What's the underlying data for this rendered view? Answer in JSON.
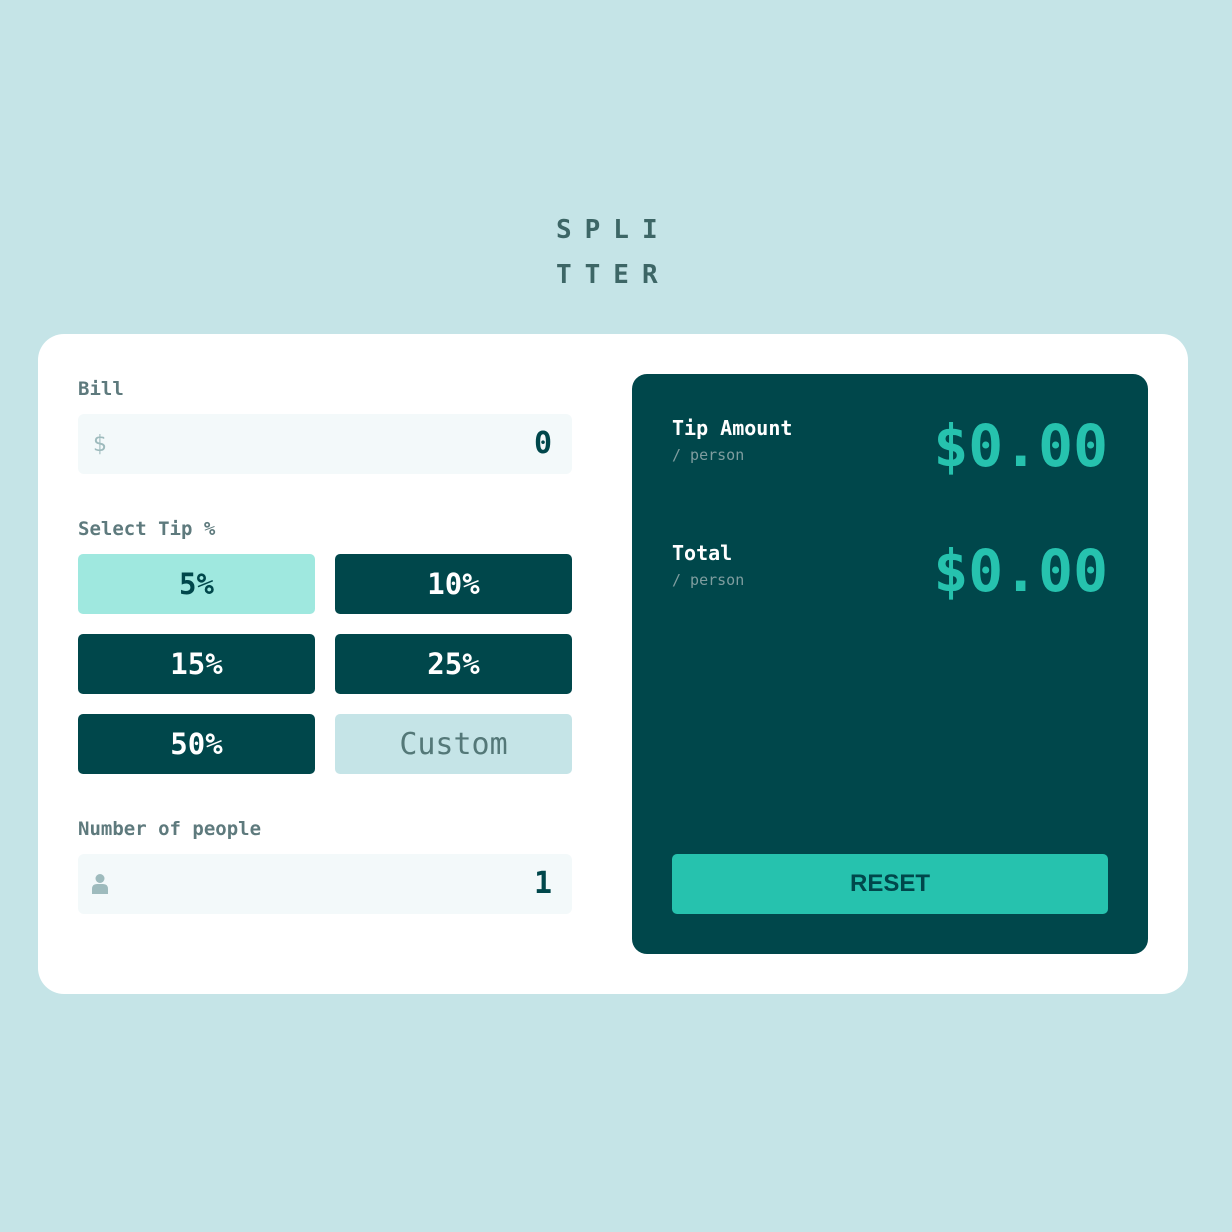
{
  "logo": {
    "line1": "SPLI",
    "line2": "TTER"
  },
  "bill": {
    "label": "Bill",
    "icon": "dollar-icon",
    "icon_glyph": "$",
    "value": "0"
  },
  "tip": {
    "label": "Select Tip %",
    "options": [
      {
        "label": "5%",
        "active": true
      },
      {
        "label": "10%",
        "active": false
      },
      {
        "label": "15%",
        "active": false
      },
      {
        "label": "25%",
        "active": false
      },
      {
        "label": "50%",
        "active": false
      }
    ],
    "custom_placeholder": "Custom"
  },
  "people": {
    "label": "Number of people",
    "icon": "person-icon",
    "value": "1"
  },
  "results": {
    "tip_amount": {
      "title": "Tip Amount",
      "sub": "/ person",
      "value": "$0.00"
    },
    "total": {
      "title": "Total",
      "sub": "/ person",
      "value": "$0.00"
    },
    "reset_label": "RESET"
  },
  "colors": {
    "background": "#c5e4e7",
    "dark": "#00474b",
    "accent": "#26c2ae",
    "active_tip": "#9fe8df"
  }
}
